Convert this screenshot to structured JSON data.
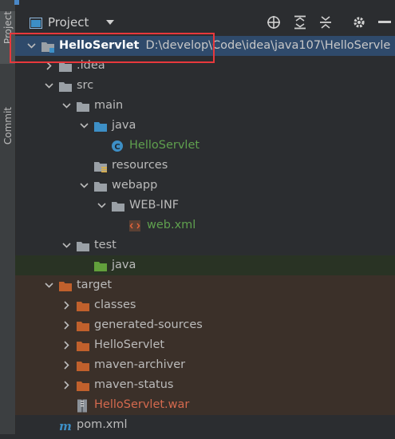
{
  "sidebar": {
    "tabs": [
      {
        "label": "Project",
        "active": true
      },
      {
        "label": "Commit",
        "active": false
      }
    ]
  },
  "header": {
    "title": "Project",
    "icons": [
      "target-icon",
      "expand-all-icon",
      "collapse-all-icon",
      "gear-icon",
      "minimize-icon"
    ]
  },
  "tree": [
    {
      "label": "HelloServlet",
      "path": "D:\\develop\\Code\\idea\\java107\\HelloServle",
      "depth": 0,
      "arrow": "down",
      "icon": "module-folder",
      "style": "bold",
      "row": "root"
    },
    {
      "label": ".idea",
      "depth": 1,
      "arrow": "right",
      "icon": "folder-gray",
      "style": "normal",
      "row": ""
    },
    {
      "label": "src",
      "depth": 1,
      "arrow": "down",
      "icon": "folder-gray",
      "style": "normal",
      "row": ""
    },
    {
      "label": "main",
      "depth": 2,
      "arrow": "down",
      "icon": "folder-gray",
      "style": "normal",
      "row": ""
    },
    {
      "label": "java",
      "depth": 3,
      "arrow": "down",
      "icon": "folder-blue",
      "style": "normal",
      "row": ""
    },
    {
      "label": "HelloServlet",
      "depth": 4,
      "arrow": "none",
      "icon": "class-c",
      "style": "green",
      "row": ""
    },
    {
      "label": "resources",
      "depth": 3,
      "arrow": "none",
      "icon": "folder-resources",
      "style": "normal",
      "row": ""
    },
    {
      "label": "webapp",
      "depth": 3,
      "arrow": "down",
      "icon": "folder-gray",
      "style": "normal",
      "row": ""
    },
    {
      "label": "WEB-INF",
      "depth": 4,
      "arrow": "down",
      "icon": "folder-gray",
      "style": "normal",
      "row": ""
    },
    {
      "label": "web.xml",
      "depth": 5,
      "arrow": "none",
      "icon": "xml-file",
      "style": "green",
      "row": ""
    },
    {
      "label": "test",
      "depth": 2,
      "arrow": "down",
      "icon": "folder-gray",
      "style": "normal",
      "row": ""
    },
    {
      "label": "java",
      "depth": 3,
      "arrow": "none",
      "icon": "folder-green",
      "style": "normal",
      "row": "test-src"
    },
    {
      "label": "target",
      "depth": 1,
      "arrow": "down",
      "icon": "folder-orange",
      "style": "normal",
      "row": "excluded"
    },
    {
      "label": "classes",
      "depth": 2,
      "arrow": "right",
      "icon": "folder-orange",
      "style": "normal",
      "row": "excluded"
    },
    {
      "label": "generated-sources",
      "depth": 2,
      "arrow": "right",
      "icon": "folder-orange",
      "style": "normal",
      "row": "excluded"
    },
    {
      "label": "HelloServlet",
      "depth": 2,
      "arrow": "right",
      "icon": "folder-orange",
      "style": "normal",
      "row": "excluded"
    },
    {
      "label": "maven-archiver",
      "depth": 2,
      "arrow": "right",
      "icon": "folder-orange",
      "style": "normal",
      "row": "excluded"
    },
    {
      "label": "maven-status",
      "depth": 2,
      "arrow": "right",
      "icon": "folder-orange",
      "style": "normal",
      "row": "excluded"
    },
    {
      "label": "HelloServlet.war",
      "depth": 2,
      "arrow": "none",
      "icon": "war-file",
      "style": "red",
      "row": "excluded"
    },
    {
      "label": "pom.xml",
      "depth": 1,
      "arrow": "none",
      "icon": "maven-m",
      "style": "normal",
      "row": ""
    }
  ],
  "colors": {
    "background": "#2b2d30",
    "selected_row": "#2f4a6b",
    "test_row": "#293324",
    "excluded_row": "#3b3029",
    "highlight_box": "#e8383c",
    "folder_gray": "#9aa0a6",
    "folder_blue": "#3d8fc6",
    "folder_green": "#62a03c",
    "folder_orange": "#c0602c"
  }
}
